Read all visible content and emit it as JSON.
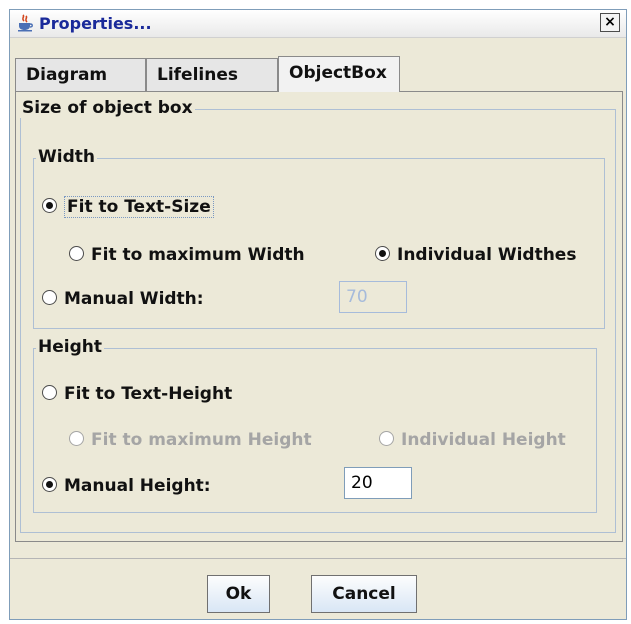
{
  "window": {
    "title": "Properties...",
    "close_label": "×"
  },
  "tabs": [
    {
      "label": "Diagram",
      "active": false
    },
    {
      "label": "Lifelines",
      "active": false
    },
    {
      "label": "ObjectBox",
      "active": true
    }
  ],
  "size_group": {
    "title": "Size of object box"
  },
  "width_group": {
    "title": "Width",
    "fit_text_size": {
      "label": "Fit to Text-Size",
      "selected": true
    },
    "fit_max_width": {
      "label": "Fit to maximum Width",
      "selected": false
    },
    "individual_widthes": {
      "label": "Individual Widthes",
      "selected": true
    },
    "manual_width": {
      "label": "Manual Width:",
      "selected": false,
      "value": "70"
    }
  },
  "height_group": {
    "title": "Height",
    "fit_text_height": {
      "label": "Fit to Text-Height",
      "selected": false
    },
    "fit_max_height": {
      "label": "Fit to maximum Height",
      "selected": false
    },
    "individual_height": {
      "label": "Individual Height",
      "selected": false
    },
    "manual_height": {
      "label": "Manual Height:",
      "selected": true,
      "value": "20"
    }
  },
  "buttons": {
    "ok": "Ok",
    "cancel": "Cancel"
  }
}
